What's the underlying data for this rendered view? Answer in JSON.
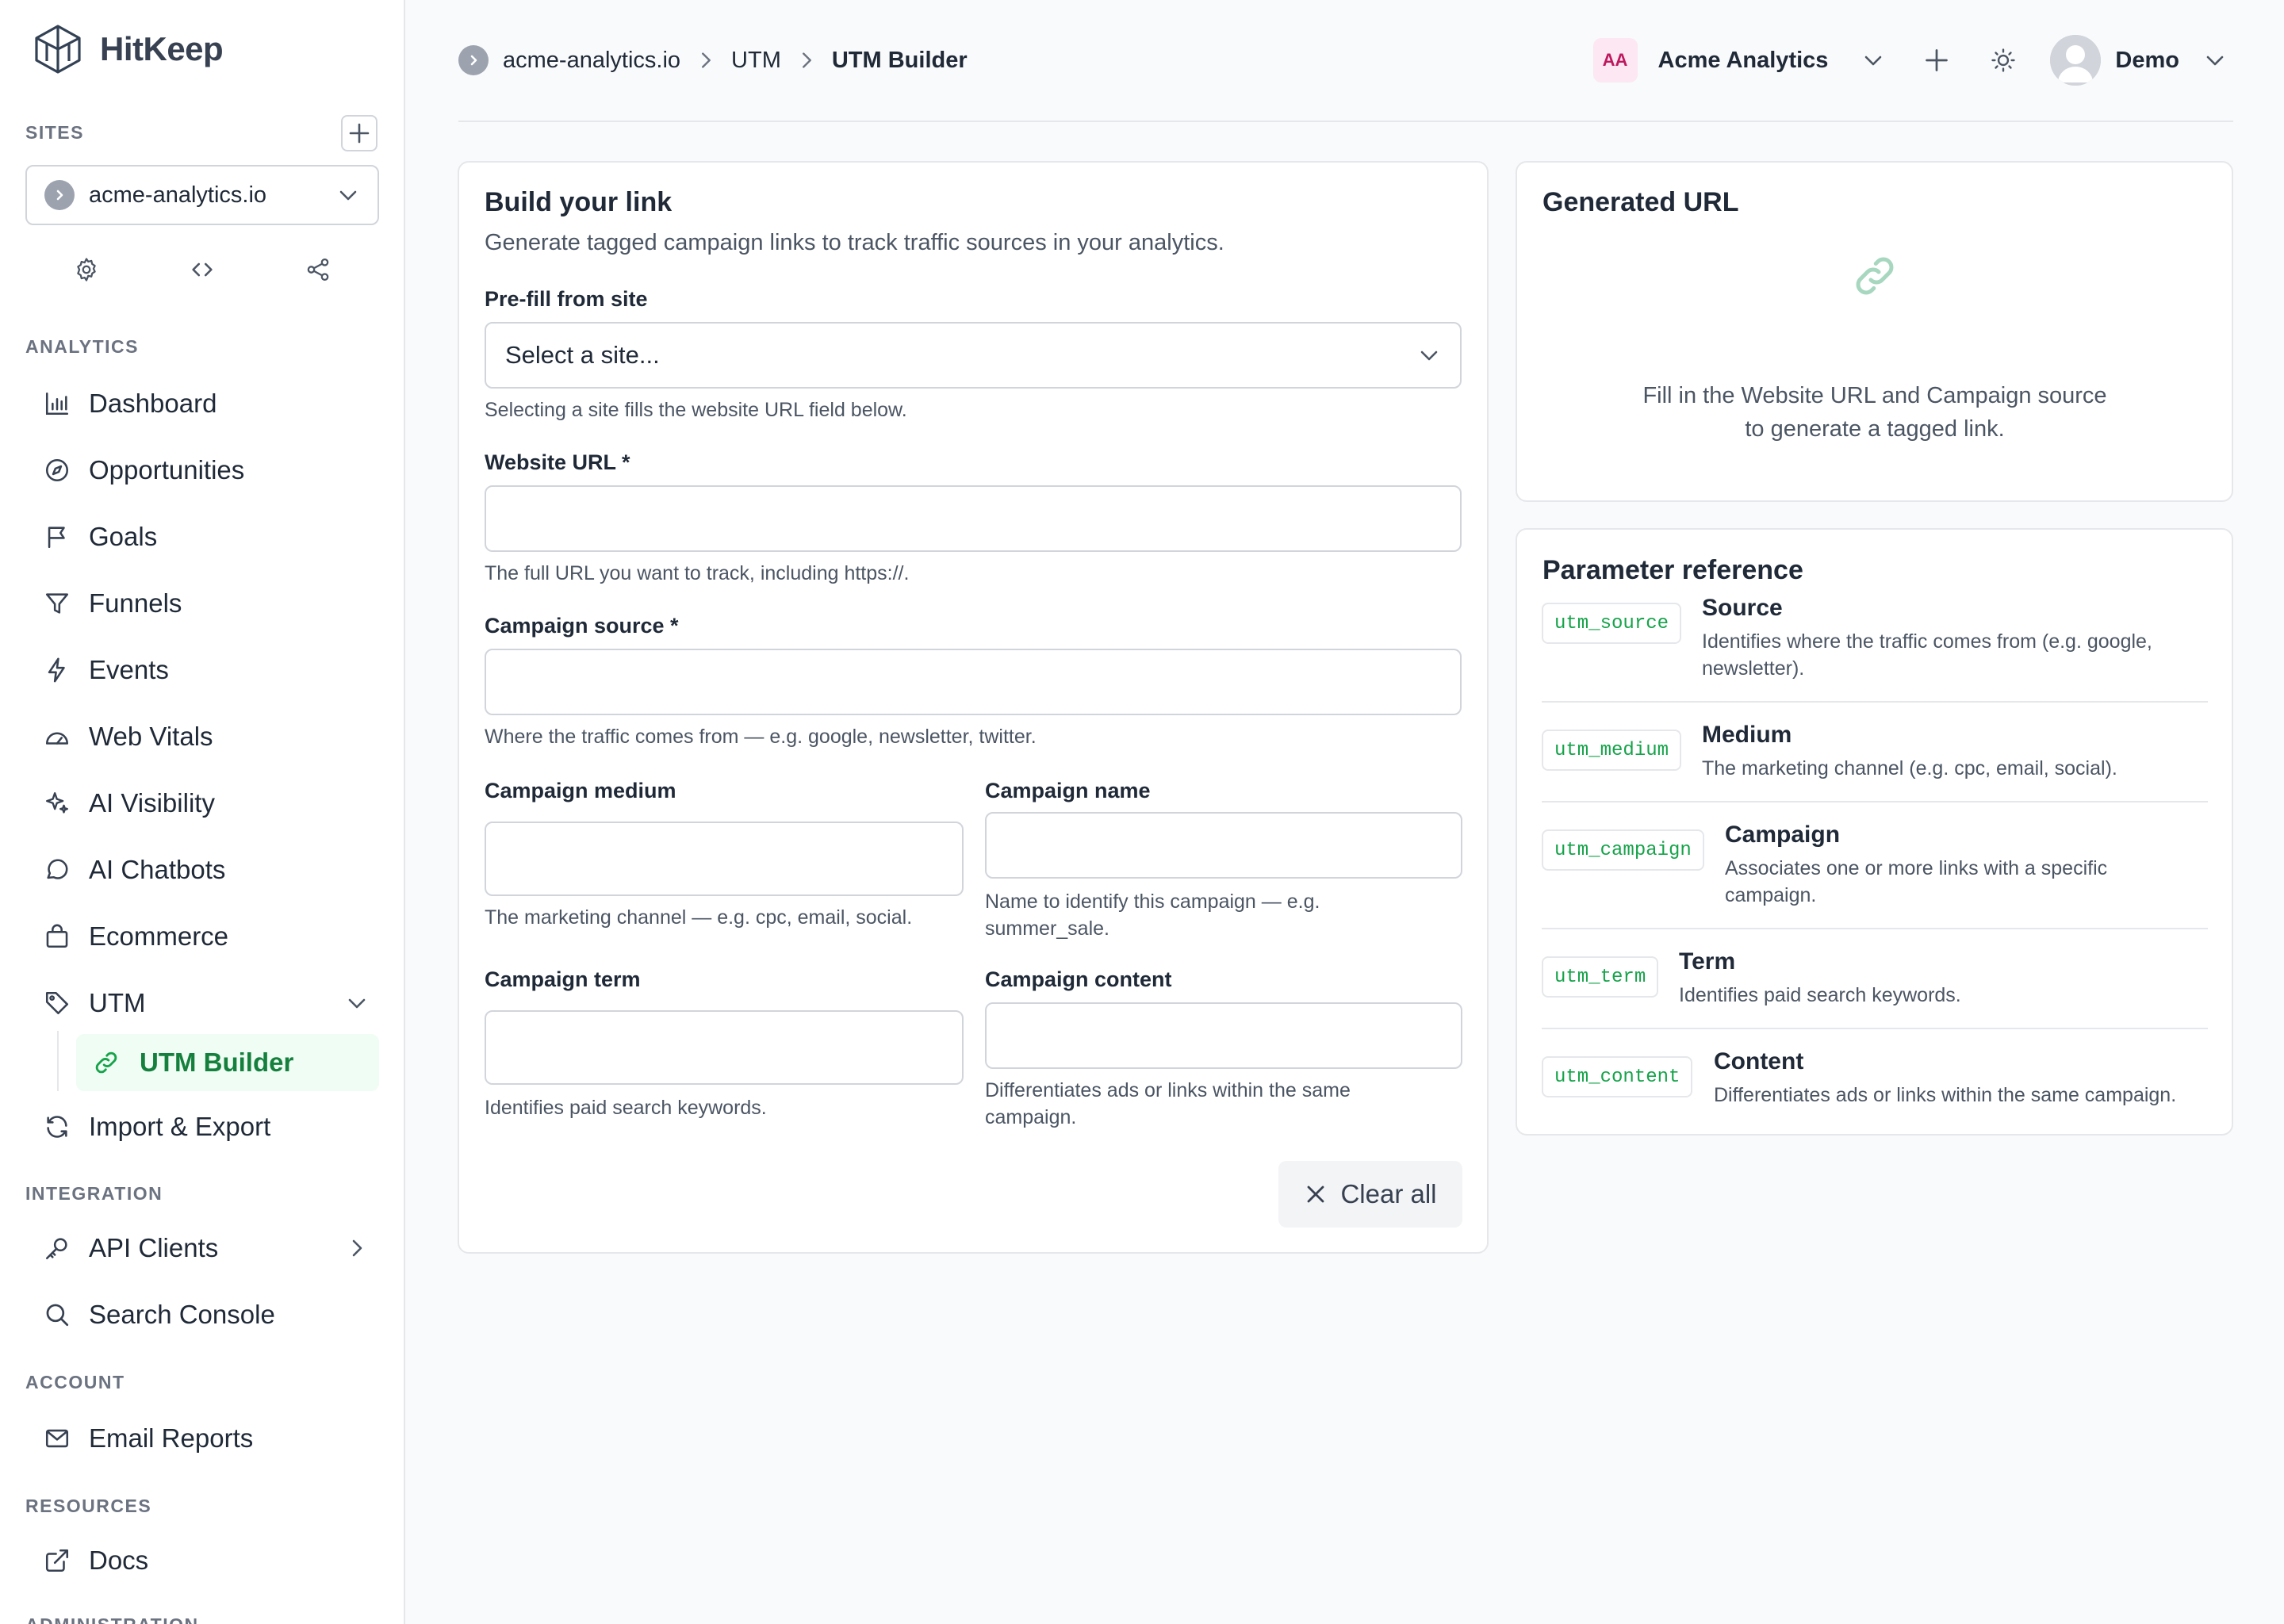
{
  "brand": {
    "name": "HitKeep"
  },
  "sidebar": {
    "sites_label": "SITES",
    "site_selected": "acme-analytics.io",
    "analytics_label": "ANALYTICS",
    "items": [
      {
        "label": "Dashboard",
        "icon": "bar-chart-icon"
      },
      {
        "label": "Opportunities",
        "icon": "compass-icon"
      },
      {
        "label": "Goals",
        "icon": "flag-icon"
      },
      {
        "label": "Funnels",
        "icon": "funnel-icon"
      },
      {
        "label": "Events",
        "icon": "lightning-icon"
      },
      {
        "label": "Web Vitals",
        "icon": "gauge-icon"
      },
      {
        "label": "AI Visibility",
        "icon": "sparkles-icon"
      },
      {
        "label": "AI Chatbots",
        "icon": "chat-bubble-icon"
      },
      {
        "label": "Ecommerce",
        "icon": "shopping-bag-icon"
      },
      {
        "label": "UTM",
        "icon": "tag-icon"
      }
    ],
    "utm_sub": {
      "label": "UTM Builder",
      "icon": "link-icon"
    },
    "import_export": {
      "label": "Import & Export",
      "icon": "sync-icon"
    },
    "integration_label": "INTEGRATION",
    "api_clients": {
      "label": "API Clients",
      "icon": "key-icon"
    },
    "search_console": {
      "label": "Search Console",
      "icon": "search-icon"
    },
    "account_label": "ACCOUNT",
    "email_reports": {
      "label": "Email Reports",
      "icon": "envelope-icon"
    },
    "resources_label": "RESOURCES",
    "docs": {
      "label": "Docs",
      "icon": "external-link-icon"
    },
    "admin_label": "ADMINISTRATION"
  },
  "header": {
    "breadcrumbs": [
      "acme-analytics.io",
      "UTM",
      "UTM Builder"
    ],
    "org_badge": "AA",
    "org_name": "Acme Analytics",
    "user_name": "Demo"
  },
  "builder": {
    "title": "Build your link",
    "subtitle": "Generate tagged campaign links to track traffic sources in your analytics.",
    "prefill_label": "Pre-fill from site",
    "prefill_placeholder": "Select a site...",
    "prefill_help": "Selecting a site fills the website URL field below.",
    "website_label": "Website URL *",
    "website_value": "",
    "website_help": "The full URL you want to track, including https://.",
    "source_label": "Campaign source *",
    "source_value": "",
    "source_help": "Where the traffic comes from — e.g. google, newsletter, twitter.",
    "medium_label": "Campaign medium",
    "medium_value": "",
    "medium_help": "The marketing channel — e.g. cpc, email, social.",
    "name_label": "Campaign name",
    "name_value": "",
    "name_help": "Name to identify this campaign — e.g. summer_sale.",
    "term_label": "Campaign term",
    "term_value": "",
    "term_help": "Identifies paid search keywords.",
    "content_label": "Campaign content",
    "content_value": "",
    "content_help": "Differentiates ads or links within the same campaign.",
    "clear_label": "Clear all"
  },
  "generated": {
    "title": "Generated URL",
    "empty_line1": "Fill in the Website URL and Campaign source",
    "empty_line2": "to generate a tagged link."
  },
  "params": {
    "title": "Parameter reference",
    "rows": [
      {
        "code": "utm_source",
        "name": "Source",
        "desc": "Identifies where the traffic comes from (e.g. google, newsletter)."
      },
      {
        "code": "utm_medium",
        "name": "Medium",
        "desc": "The marketing channel (e.g. cpc, email, social)."
      },
      {
        "code": "utm_campaign",
        "name": "Campaign",
        "desc": "Associates one or more links with a specific campaign."
      },
      {
        "code": "utm_term",
        "name": "Term",
        "desc": "Identifies paid search keywords."
      },
      {
        "code": "utm_content",
        "name": "Content",
        "desc": "Differentiates ads or links within the same campaign."
      }
    ]
  },
  "colors": {
    "accent": "#16a34a",
    "accent_bg": "#f0fdf4",
    "border": "#e5e7eb",
    "badge_bg": "#fce7f3",
    "badge_fg": "#be185d"
  }
}
